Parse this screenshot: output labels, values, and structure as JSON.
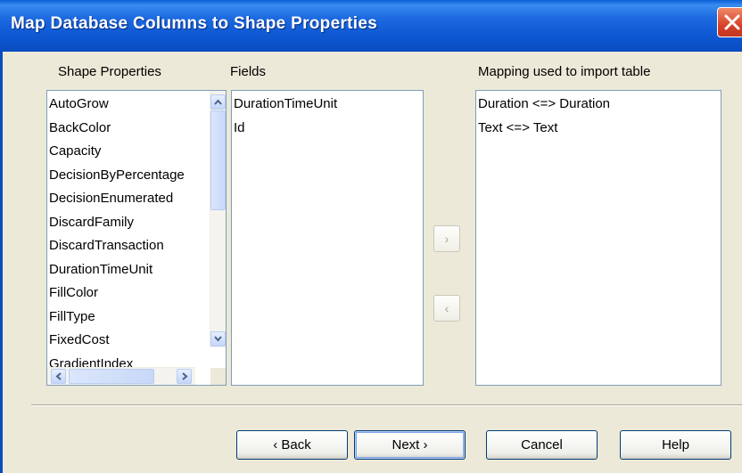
{
  "window": {
    "title": "Map Database Columns to Shape Properties"
  },
  "labels": {
    "shape_properties": "Shape Properties",
    "fields": "Fields",
    "mapping": "Mapping used to import table"
  },
  "shape_properties": [
    "AutoGrow",
    "BackColor",
    "Capacity",
    "DecisionByPercentage",
    "DecisionEnumerated",
    "DiscardFamily",
    "DiscardTransaction",
    "DurationTimeUnit",
    "FillColor",
    "FillType",
    "FixedCost",
    "GradientIndex"
  ],
  "fields": [
    "DurationTimeUnit",
    "Id"
  ],
  "mappings": [
    "Duration <=> Duration",
    "Text <=> Text"
  ],
  "arrows": {
    "add": "›",
    "remove": "‹"
  },
  "buttons": {
    "back": "‹ Back",
    "next": "Next ›",
    "cancel": "Cancel",
    "help": "Help"
  },
  "icons": {
    "close": "close-icon",
    "scroll_up": "chevron-up-icon",
    "scroll_down": "chevron-down-icon",
    "scroll_left": "chevron-left-icon",
    "scroll_right": "chevron-right-icon"
  }
}
